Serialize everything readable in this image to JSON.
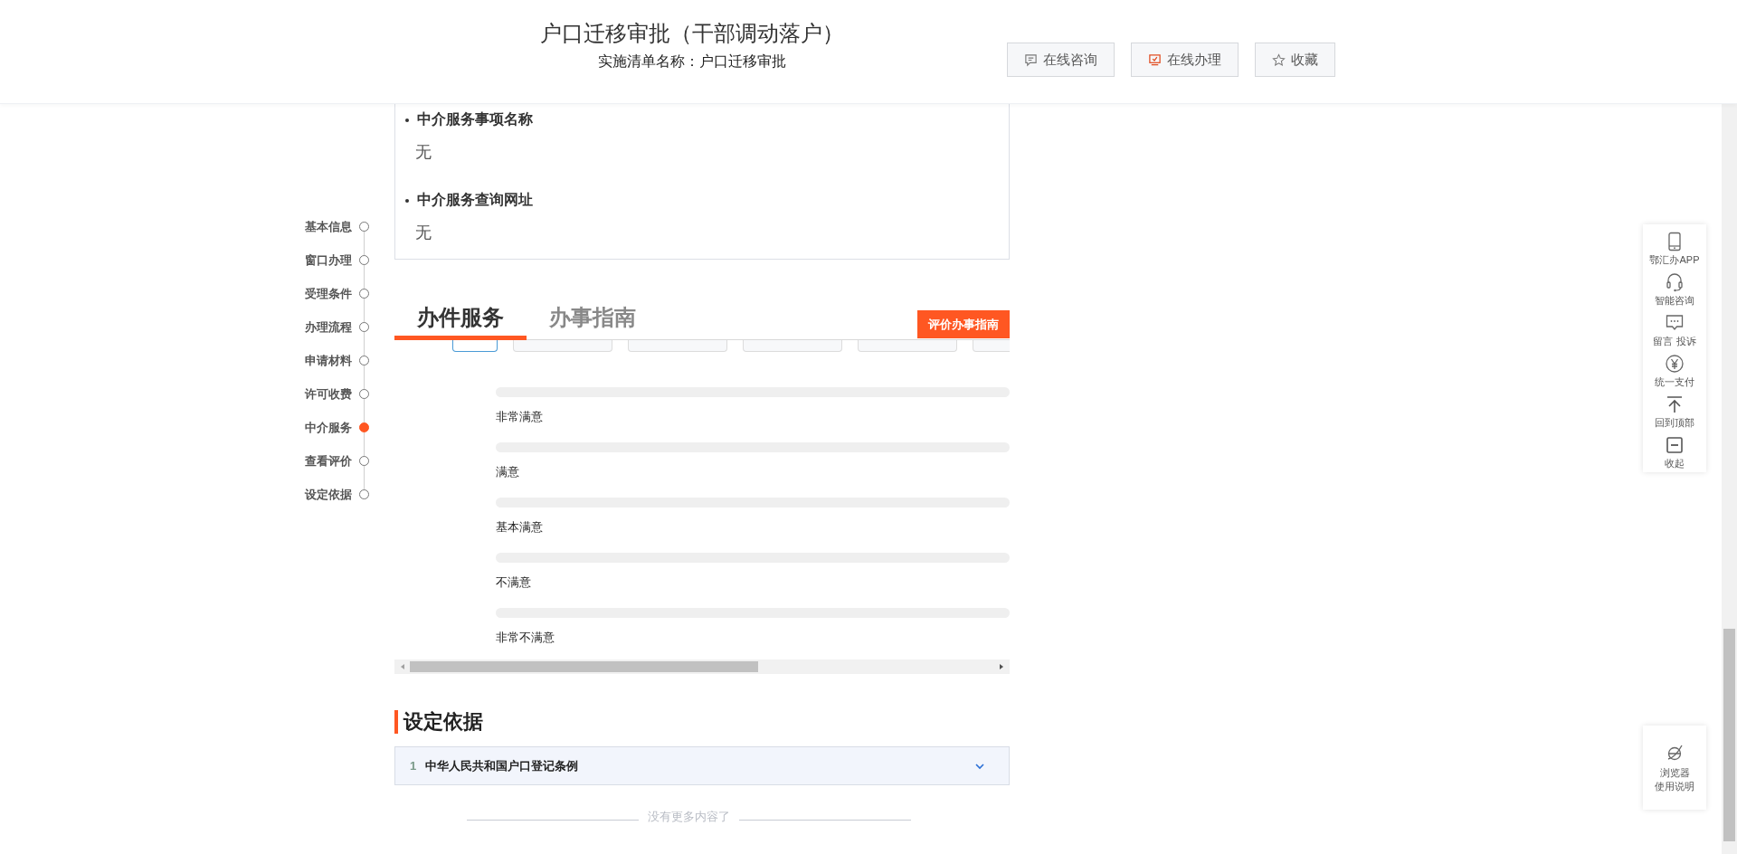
{
  "header": {
    "title": "户口迁移审批（干部调动落户）",
    "subtitle": "实施清单名称：户口迁移审批",
    "buttons": [
      {
        "kind": "consult",
        "label": "在线咨询"
      },
      {
        "kind": "apply",
        "label": "在线办理"
      },
      {
        "kind": "favorite",
        "label": "收藏"
      }
    ]
  },
  "side_nav": [
    {
      "label": "基本信息",
      "selected": false
    },
    {
      "label": "窗口办理",
      "selected": false
    },
    {
      "label": "受理条件",
      "selected": false
    },
    {
      "label": "办理流程",
      "selected": false
    },
    {
      "label": "申请材料",
      "selected": false
    },
    {
      "label": "许可收费",
      "selected": false
    },
    {
      "label": "中介服务",
      "selected": true
    },
    {
      "label": "查看评价",
      "selected": false
    },
    {
      "label": "设定依据",
      "selected": false
    }
  ],
  "intermediary": [
    {
      "title": "中介服务事项名称",
      "value": "无"
    },
    {
      "title": "中介服务查询网址",
      "value": "无"
    }
  ],
  "tabs": [
    {
      "label": "办件服务",
      "selected": true
    },
    {
      "label": "办事指南",
      "selected": false
    }
  ],
  "rate_button": "评价办事指南",
  "rating_tabs": [
    {
      "selected": true
    },
    {
      "selected": false
    },
    {
      "selected": false
    },
    {
      "selected": false
    },
    {
      "selected": false
    },
    {
      "selected": false
    }
  ],
  "ratings": [
    {
      "label": "非常满意",
      "level": 0
    },
    {
      "label": "满意",
      "level": 0
    },
    {
      "label": "基本满意",
      "level": 0
    },
    {
      "label": "不满意",
      "level": 0
    },
    {
      "label": "非常不满意",
      "level": 0
    }
  ],
  "basis": {
    "heading": "设定依据",
    "items": [
      {
        "number": "1",
        "title": "中华人民共和国户口登记条例",
        "expanded": false
      }
    ]
  },
  "end_note": "没有更多内容了",
  "float_toolbar": [
    {
      "kind": "phone",
      "label": "鄂汇办APP"
    },
    {
      "kind": "headset",
      "label": "智能咨询"
    },
    {
      "kind": "message",
      "label": "留言 投诉"
    },
    {
      "kind": "payment",
      "label": "统一支付"
    },
    {
      "kind": "top",
      "label": "回到顶部"
    },
    {
      "kind": "collapse",
      "label": "收起"
    }
  ],
  "browser_help": {
    "lines": [
      "浏览器",
      "使用说明"
    ]
  }
}
